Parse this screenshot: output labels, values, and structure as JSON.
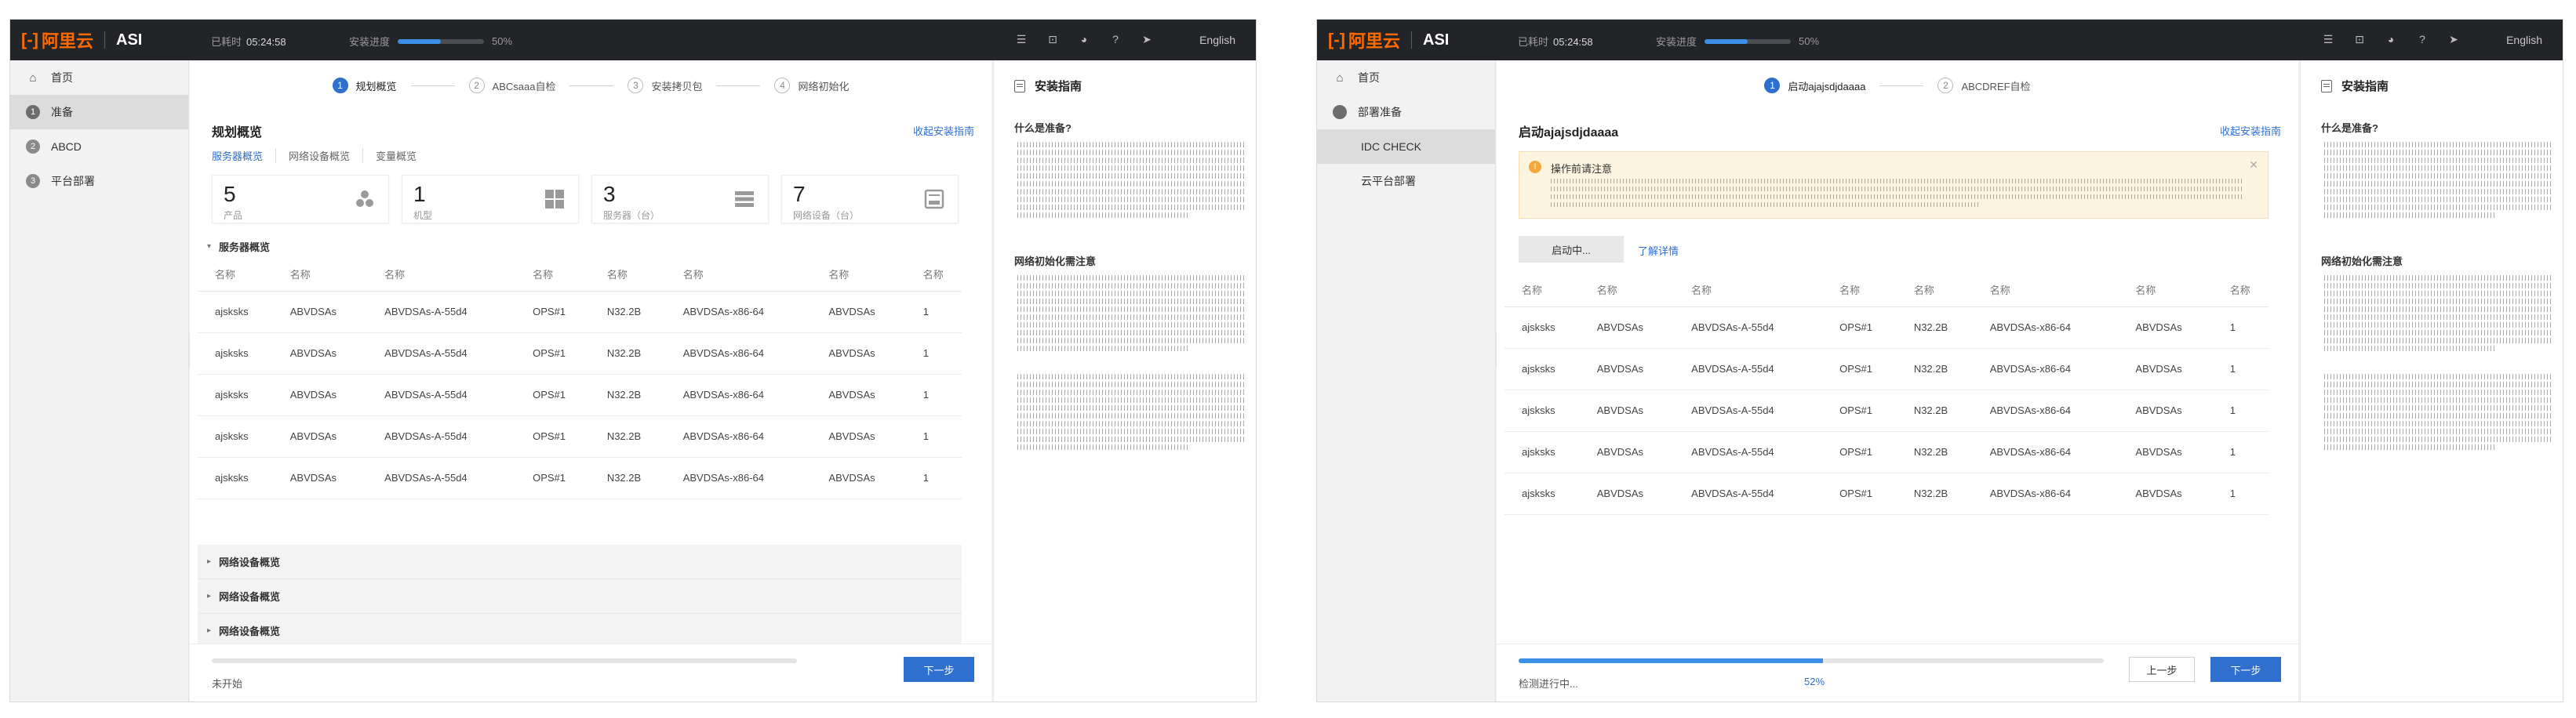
{
  "screen1": {
    "topbar": {
      "logo_mark": "[-]",
      "logo_text": "阿里云",
      "product": "ASI",
      "elapsed_label": "已耗时",
      "elapsed_value": "05:24:58",
      "progress_label": "安装进度",
      "progress_value": "50%",
      "progress_fraction": 0.5,
      "icons": [
        "list-icon",
        "box-icon",
        "globe-icon",
        "help-icon",
        "pointer-icon"
      ],
      "language": "English"
    },
    "sidebar": {
      "items": [
        {
          "badge": "",
          "icon": "home-icon",
          "label": "首页"
        },
        {
          "badge": "1",
          "label": "准备",
          "active": true
        },
        {
          "badge": "2",
          "label": "ABCD"
        },
        {
          "badge": "3",
          "label": "平台部署"
        }
      ]
    },
    "steps": [
      {
        "num": "1",
        "label": "规划概览"
      },
      {
        "num": "2",
        "label": "ABCsaaa自检"
      },
      {
        "num": "3",
        "label": "安装拷贝包"
      },
      {
        "num": "4",
        "label": "网络初始化"
      }
    ],
    "main": {
      "title": "规划概览",
      "collapse_guide": "收起安装指南",
      "subtabs": [
        "服务器概览",
        "网络设备概览",
        "变量概览"
      ],
      "stats": [
        {
          "value": "5",
          "label": "产品"
        },
        {
          "value": "1",
          "label": "机型"
        },
        {
          "value": "3",
          "label": "服务器（台）"
        },
        {
          "value": "7",
          "label": "网络设备（台）"
        }
      ],
      "server_group_title": "服务器概览",
      "table": {
        "headers": [
          "名称",
          "名称",
          "名称",
          "名称",
          "名称",
          "名称",
          "名称",
          "名称"
        ],
        "rows": [
          [
            "ajsksks",
            "ABVDSAs",
            "ABVDSAs-A-55d4",
            "OPS#1",
            "N32.2B",
            "ABVDSAs-x86-64",
            "ABVDSAs",
            "1"
          ],
          [
            "ajsksks",
            "ABVDSAs",
            "ABVDSAs-A-55d4",
            "OPS#1",
            "N32.2B",
            "ABVDSAs-x86-64",
            "ABVDSAs",
            "1"
          ],
          [
            "ajsksks",
            "ABVDSAs",
            "ABVDSAs-A-55d4",
            "OPS#1",
            "N32.2B",
            "ABVDSAs-x86-64",
            "ABVDSAs",
            "1"
          ],
          [
            "ajsksks",
            "ABVDSAs",
            "ABVDSAs-A-55d4",
            "OPS#1",
            "N32.2B",
            "ABVDSAs-x86-64",
            "ABVDSAs",
            "1"
          ],
          [
            "ajsksks",
            "ABVDSAs",
            "ABVDSAs-A-55d4",
            "OPS#1",
            "N32.2B",
            "ABVDSAs-x86-64",
            "ABVDSAs",
            "1"
          ]
        ]
      },
      "folded_groups": [
        "网络设备概览",
        "网络设备概览",
        "网络设备概览"
      ]
    },
    "footer": {
      "status": "未开始",
      "progress_fraction": 0,
      "next_label": "下一步"
    },
    "guide": {
      "title": "安装指南",
      "q1": "什么是准备?",
      "q2": "网络初始化需注意"
    }
  },
  "screen2": {
    "topbar": {
      "logo_mark": "[-]",
      "logo_text": "阿里云",
      "product": "ASI",
      "elapsed_label": "已耗时",
      "elapsed_value": "05:24:58",
      "progress_label": "安装进度",
      "progress_value": "50%",
      "progress_fraction": 0.5,
      "icons": [
        "list-icon",
        "box-icon",
        "globe-icon",
        "help-icon",
        "pointer-icon"
      ],
      "language": "English"
    },
    "sidebar": {
      "items": [
        {
          "icon": "home-icon",
          "label": "首页"
        },
        {
          "badge": "",
          "label": "部署准备"
        },
        {
          "label": "IDC CHECK",
          "active": true,
          "sub": true
        },
        {
          "label": "云平台部署",
          "sub": true
        }
      ]
    },
    "steps": [
      {
        "num": "1",
        "label": "启动ajajsdjdaaaa"
      },
      {
        "num": "2",
        "label": "ABCDREF自检"
      }
    ],
    "main": {
      "title": "启动ajajsdjdaaaa",
      "collapse_guide": "收起安装指南",
      "warning_title": "操作前请注意",
      "start_button": "启动中...",
      "detail_link": "了解详情",
      "table": {
        "headers": [
          "名称",
          "名称",
          "名称",
          "名称",
          "名称",
          "名称",
          "名称",
          "名称"
        ],
        "rows": [
          [
            "ajsksks",
            "ABVDSAs",
            "ABVDSAs-A-55d4",
            "OPS#1",
            "N32.2B",
            "ABVDSAs-x86-64",
            "ABVDSAs",
            "1"
          ],
          [
            "ajsksks",
            "ABVDSAs",
            "ABVDSAs-A-55d4",
            "OPS#1",
            "N32.2B",
            "ABVDSAs-x86-64",
            "ABVDSAs",
            "1"
          ],
          [
            "ajsksks",
            "ABVDSAs",
            "ABVDSAs-A-55d4",
            "OPS#1",
            "N32.2B",
            "ABVDSAs-x86-64",
            "ABVDSAs",
            "1"
          ],
          [
            "ajsksks",
            "ABVDSAs",
            "ABVDSAs-A-55d4",
            "OPS#1",
            "N32.2B",
            "ABVDSAs-x86-64",
            "ABVDSAs",
            "1"
          ],
          [
            "ajsksks",
            "ABVDSAs",
            "ABVDSAs-A-55d4",
            "OPS#1",
            "N32.2B",
            "ABVDSAs-x86-64",
            "ABVDSAs",
            "1"
          ]
        ]
      }
    },
    "footer": {
      "status": "检测进行中...",
      "percent": "52%",
      "progress_fraction": 0.52,
      "prev_label": "上一步",
      "next_label": "下一步"
    },
    "guide": {
      "title": "安装指南",
      "q1": "什么是准备?",
      "q2": "网络初始化需注意"
    }
  },
  "colors": {
    "topbar_bg": "#222427",
    "brand_orange": "#ff6a00",
    "primary_blue": "#2f6fce",
    "warning_bg": "#fdf4e0"
  }
}
